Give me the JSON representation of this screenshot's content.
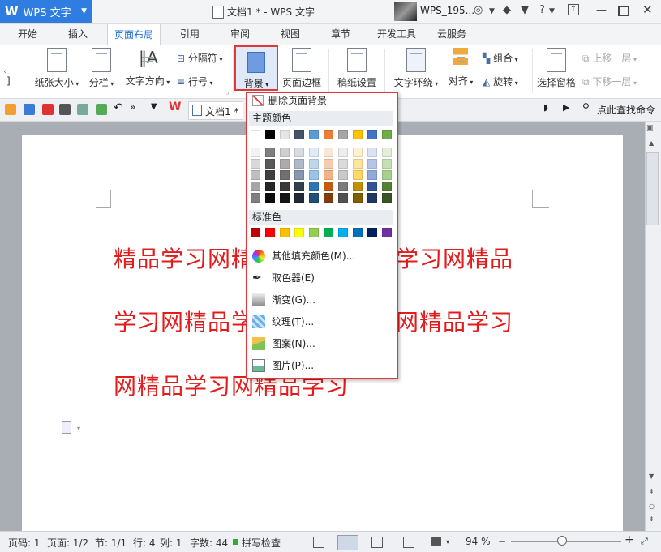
{
  "titlebar": {
    "app_logo": "W",
    "app_name": "WPS 文字",
    "doc_title": "文档1 * - WPS 文字",
    "username": "WPS_195...",
    "help": "?"
  },
  "tabs": [
    "开始",
    "插入",
    "页面布局",
    "引用",
    "审阅",
    "视图",
    "章节",
    "开发工具",
    "云服务"
  ],
  "active_tab": "页面布局",
  "ribbon": {
    "paper_size": "纸张大小",
    "columns": "分栏",
    "text_direction": "文字方向",
    "separator": "分隔符",
    "line_number": "行号",
    "background": "背景",
    "page_border": "页面边框",
    "manuscript": "稿纸设置",
    "text_wrap": "文字环绕",
    "align": "对齐",
    "group": "组合",
    "rotate": "旋转",
    "selection_pane": "选择窗格",
    "bring_forward": "上移一层",
    "send_backward": "下移一层"
  },
  "quickbar": {
    "doc_tab": "文档1 *",
    "search": "点此查找命令"
  },
  "document": {
    "lines": [
      "精品学习网精品学习网精品学习网精品",
      "学习网精品学习网精品学习网精品学习",
      "网精品学习网精品学习"
    ]
  },
  "dropdown": {
    "remove_bg": "删除页面背景",
    "theme_colors_label": "主题颜色",
    "standard_colors_label": "标准色",
    "theme_top": [
      "#ffffff",
      "#000000",
      "#e7e6e6",
      "#44546a",
      "#5b9bd5",
      "#ed7d31",
      "#a5a5a5",
      "#ffc000",
      "#4472c4",
      "#70ad47"
    ],
    "theme_shades": [
      [
        "#f2f2f2",
        "#7f7f7f",
        "#d0cece",
        "#d6dce4",
        "#deebf6",
        "#fbe5d5",
        "#ededed",
        "#fff2cc",
        "#dae3f3",
        "#e2efd9"
      ],
      [
        "#d8d8d8",
        "#595959",
        "#aeabab",
        "#adb9ca",
        "#bdd7ee",
        "#f7cbac",
        "#dbdbdb",
        "#fee599",
        "#b4c6e7",
        "#c5e0b3"
      ],
      [
        "#bfbfbf",
        "#3f3f3f",
        "#757070",
        "#8496b0",
        "#9dc3e6",
        "#f4b183",
        "#c9c9c9",
        "#ffd965",
        "#8eaadb",
        "#a8d08d"
      ],
      [
        "#a5a5a5",
        "#262626",
        "#3a3838",
        "#323f4f",
        "#2e75b5",
        "#c55a11",
        "#7b7b7b",
        "#bf9000",
        "#2f5496",
        "#538135"
      ],
      [
        "#7f7f7f",
        "#0c0c0c",
        "#171616",
        "#222a35",
        "#1e4e79",
        "#833c0b",
        "#525252",
        "#7f6000",
        "#1f3864",
        "#375623"
      ]
    ],
    "standard": [
      "#c00000",
      "#ff0000",
      "#ffc000",
      "#ffff00",
      "#92d050",
      "#00b050",
      "#00b0f0",
      "#0070c0",
      "#002060",
      "#7030a0"
    ],
    "items": {
      "more_fill": "其他填充颜色(M)...",
      "picker": "取色器(E)",
      "gradient": "渐变(G)...",
      "texture": "纹理(T)...",
      "pattern": "图案(N)...",
      "picture": "图片(P)..."
    }
  },
  "statusbar": {
    "page_num": "页码: 1",
    "page_of": "页面: 1/2",
    "section": "节: 1/1",
    "row": "行: 4",
    "col": "列: 1",
    "word_count": "字数: 44",
    "spell": "拼写检查",
    "zoom": "94 %",
    "minus": "−",
    "plus": "+"
  },
  "colors": {
    "accent": "#2f7de0",
    "highlight_red": "#e0373d",
    "doc_text": "#e31b1b"
  }
}
